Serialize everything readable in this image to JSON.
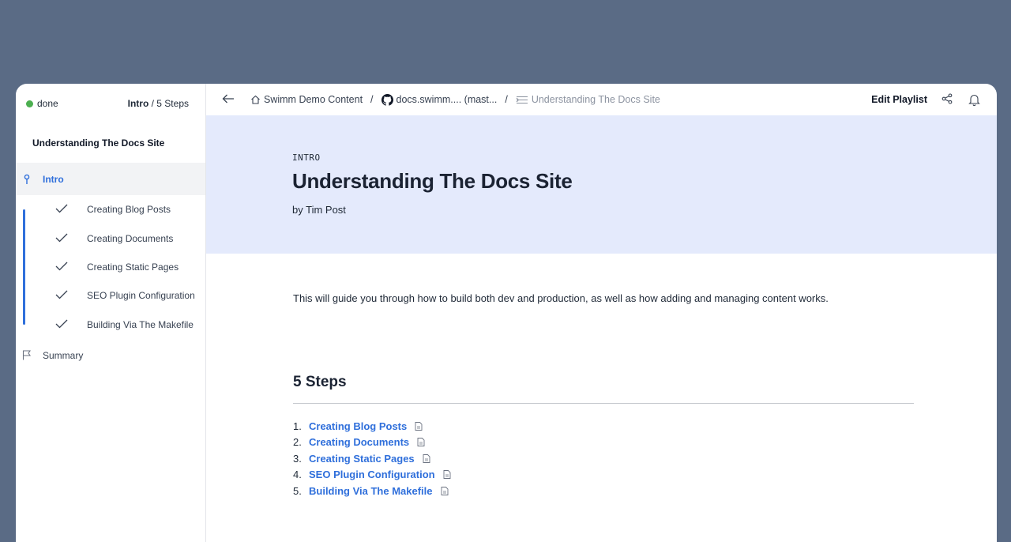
{
  "sidebar": {
    "status": "done",
    "progress_current": "Intro",
    "progress_rest": " / 5 Steps",
    "title": "Understanding The Docs Site",
    "intro_label": "Intro",
    "steps": [
      {
        "label": "Creating Blog Posts"
      },
      {
        "label": "Creating Documents"
      },
      {
        "label": "Creating Static Pages"
      },
      {
        "label": "SEO Plugin Configuration"
      },
      {
        "label": "Building Via The Makefile"
      }
    ],
    "summary_label": "Summary",
    "colors": {
      "status_dot": "#4caf50",
      "accent": "#2f6fdb"
    }
  },
  "topbar": {
    "breadcrumbs": [
      {
        "label": "Swimm Demo Content",
        "icon": "home-icon"
      },
      {
        "label": "docs.swimm.... (mast...",
        "icon": "github-icon"
      },
      {
        "label": "Understanding The Docs Site",
        "icon": "playlist-icon"
      }
    ],
    "separator": "/",
    "edit_label": "Edit Playlist"
  },
  "hero": {
    "label": "INTRO",
    "title": "Understanding The Docs Site",
    "author": "by Tim Post",
    "background": "#e4eafc"
  },
  "content": {
    "intro_text": "This will guide you through how to build both dev and production, as well as how adding and managing content works.",
    "steps_title": "5 Steps",
    "steps": [
      {
        "num": "1.",
        "label": "Creating Blog Posts"
      },
      {
        "num": "2.",
        "label": "Creating Documents"
      },
      {
        "num": "3.",
        "label": "Creating Static Pages"
      },
      {
        "num": "4.",
        "label": "SEO Plugin Configuration"
      },
      {
        "num": "5.",
        "label": "Building Via The Makefile"
      }
    ]
  }
}
